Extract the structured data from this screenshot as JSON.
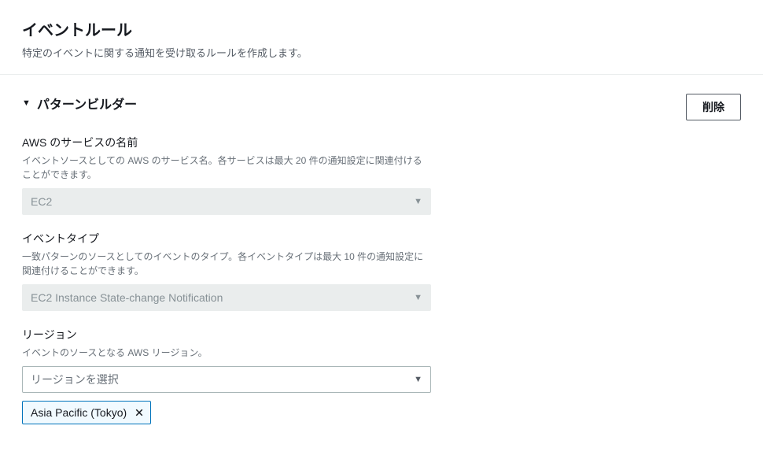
{
  "header": {
    "title": "イベントルール",
    "description": "特定のイベントに関する通知を受け取るルールを作成します。"
  },
  "section": {
    "title": "パターンビルダー",
    "delete_label": "削除"
  },
  "fields": {
    "service": {
      "label": "AWS のサービスの名前",
      "description": "イベントソースとしての AWS のサービス名。各サービスは最大 20 件の通知設定に関連付けることができます。",
      "value": "EC2"
    },
    "event_type": {
      "label": "イベントタイプ",
      "description": "一致パターンのソースとしてのイベントのタイプ。各イベントタイプは最大 10 件の通知設定に関連付けることができます。",
      "value": "EC2 Instance State-change Notification"
    },
    "region": {
      "label": "リージョン",
      "description": "イベントのソースとなる AWS リージョン。",
      "placeholder": "リージョンを選択",
      "selected_token": "Asia Pacific (Tokyo)"
    }
  }
}
